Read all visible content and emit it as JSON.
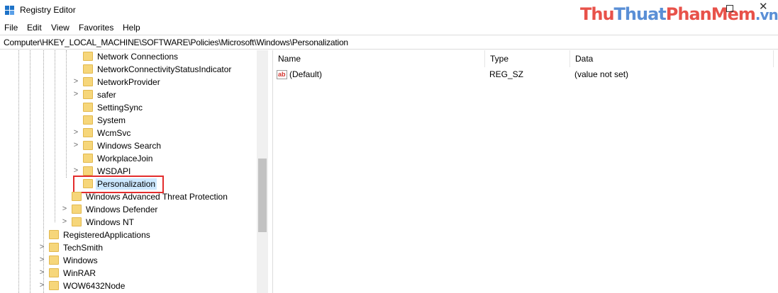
{
  "window": {
    "title": "Registry Editor",
    "maximize_glyph": "",
    "close_glyph": "✕"
  },
  "watermark": {
    "part1": "Thu",
    "part2": "Thuat",
    "part3": "PhanMem",
    "part4": ".vn"
  },
  "menu": [
    "File",
    "Edit",
    "View",
    "Favorites",
    "Help"
  ],
  "address": "Computer\\HKEY_LOCAL_MACHINE\\SOFTWARE\\Policies\\Microsoft\\Windows\\Personalization",
  "tree": {
    "items": [
      {
        "label": "Network Connections",
        "expandable": false
      },
      {
        "label": "NetworkConnectivityStatusIndicator",
        "expandable": false
      },
      {
        "label": "NetworkProvider",
        "expandable": true
      },
      {
        "label": "safer",
        "expandable": true
      },
      {
        "label": "SettingSync",
        "expandable": false
      },
      {
        "label": "System",
        "expandable": false
      },
      {
        "label": "WcmSvc",
        "expandable": true
      },
      {
        "label": "Windows Search",
        "expandable": true
      },
      {
        "label": "WorkplaceJoin",
        "expandable": false
      },
      {
        "label": "WSDAPI",
        "expandable": true
      },
      {
        "label": "Personalization",
        "expandable": false,
        "selected": true
      },
      {
        "label": "Windows Advanced Threat Protection",
        "expandable": false
      },
      {
        "label": "Windows Defender",
        "expandable": true
      },
      {
        "label": "Windows NT",
        "expandable": true
      },
      {
        "label": "RegisteredApplications",
        "expandable": false
      },
      {
        "label": "TechSmith",
        "expandable": true
      },
      {
        "label": "Windows",
        "expandable": true
      },
      {
        "label": "WinRAR",
        "expandable": true
      },
      {
        "label": "WOW6432Node",
        "expandable": true
      }
    ],
    "chevron_glyph": ">"
  },
  "list": {
    "columns": [
      "Name",
      "Type",
      "Data"
    ],
    "rows": [
      {
        "icon": "ab",
        "name": "(Default)",
        "type": "REG_SZ",
        "data": "(value not set)"
      }
    ]
  },
  "colors": {
    "highlight_box": "#e32d2d",
    "selection": "#cce8ff",
    "folder": "#f6d67a"
  }
}
